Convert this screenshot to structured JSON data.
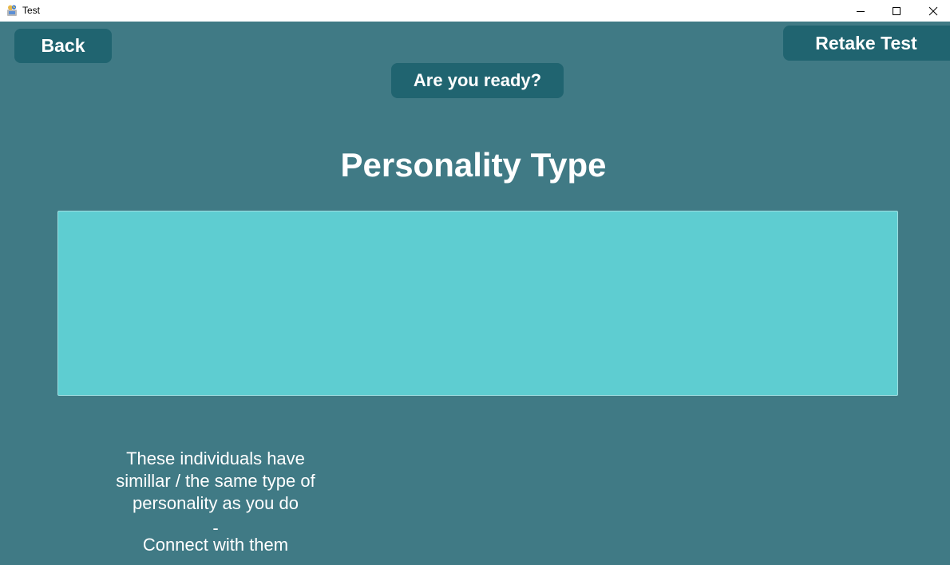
{
  "window": {
    "title": "Test",
    "icon": "app-icon",
    "controls": {
      "minimize_icon": "minimize-icon",
      "maximize_icon": "maximize-icon",
      "close_icon": "close-icon"
    }
  },
  "nav": {
    "back_label": "Back",
    "retake_label": "Retake Test",
    "ready_label": "Are you ready?"
  },
  "main": {
    "title": "Personality Type",
    "description_lines": [
      "These individuals have",
      "simillar / the same type of",
      "personality as you do"
    ],
    "separator": "-",
    "connect_text": "Connect with them"
  },
  "colors": {
    "background": "#407a85",
    "button": "#206470",
    "result_box": "#5ecdd1",
    "text": "#ffffff"
  }
}
